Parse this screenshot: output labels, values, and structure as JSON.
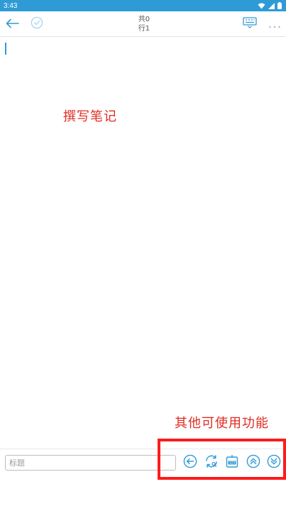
{
  "status_bar": {
    "time": "3:43",
    "icons": [
      "wifi-icon",
      "cellular-icon",
      "battery-icon"
    ]
  },
  "toolbar": {
    "back_icon": "arrow-left-icon",
    "done_icon": "check-circle-icon",
    "counter_total": "共0",
    "counter_line": "行1",
    "keyboard_icon": "keyboard-icon",
    "more_icon": "more-horizontal-icon"
  },
  "editor": {
    "content": "",
    "annotation_write": "撰写笔记"
  },
  "annotation_other": "其他可使用功能",
  "bottom_bar": {
    "title_placeholder": "标题",
    "title_value": "",
    "buttons": [
      {
        "icon": "arrow-left-circle-icon"
      },
      {
        "icon": "refresh-search-icon"
      },
      {
        "icon": "numeric-keypad-icon"
      },
      {
        "icon": "scroll-up-icon"
      },
      {
        "icon": "scroll-down-icon"
      }
    ]
  },
  "colors": {
    "accent": "#2f9bd6",
    "annotation_red": "#e02b20",
    "highlight_red": "#ff1a1a"
  }
}
